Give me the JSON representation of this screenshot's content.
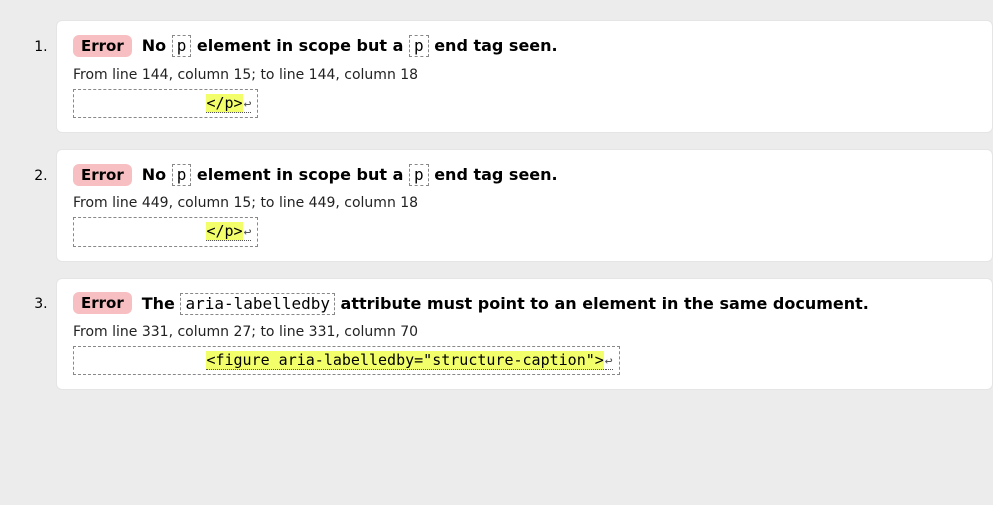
{
  "badge_label": "Error",
  "items": [
    {
      "message_parts": [
        {
          "t": "text",
          "v": "No "
        },
        {
          "t": "code",
          "v": "p"
        },
        {
          "t": "text",
          "v": " element in scope but a "
        },
        {
          "t": "code",
          "v": "p"
        },
        {
          "t": "text",
          "v": " end tag seen."
        }
      ],
      "location": "From line 144, column 15; to line 144, column 18",
      "extract_pad": "              ",
      "extract_hl": "</p>",
      "extract_tail": "↩"
    },
    {
      "message_parts": [
        {
          "t": "text",
          "v": "No "
        },
        {
          "t": "code",
          "v": "p"
        },
        {
          "t": "text",
          "v": " element in scope but a "
        },
        {
          "t": "code",
          "v": "p"
        },
        {
          "t": "text",
          "v": " end tag seen."
        }
      ],
      "location": "From line 449, column 15; to line 449, column 18",
      "extract_pad": "              ",
      "extract_hl": "</p>",
      "extract_tail": "↩"
    },
    {
      "message_parts": [
        {
          "t": "text",
          "v": "The "
        },
        {
          "t": "code",
          "v": "aria-labelledby"
        },
        {
          "t": "text",
          "v": " attribute must point to an element in the same document."
        }
      ],
      "location": "From line 331, column 27; to line 331, column 70",
      "extract_pad": "              ",
      "extract_hl": "<figure aria-labelledby=\"structure-caption\">",
      "extract_tail": "↩"
    }
  ]
}
